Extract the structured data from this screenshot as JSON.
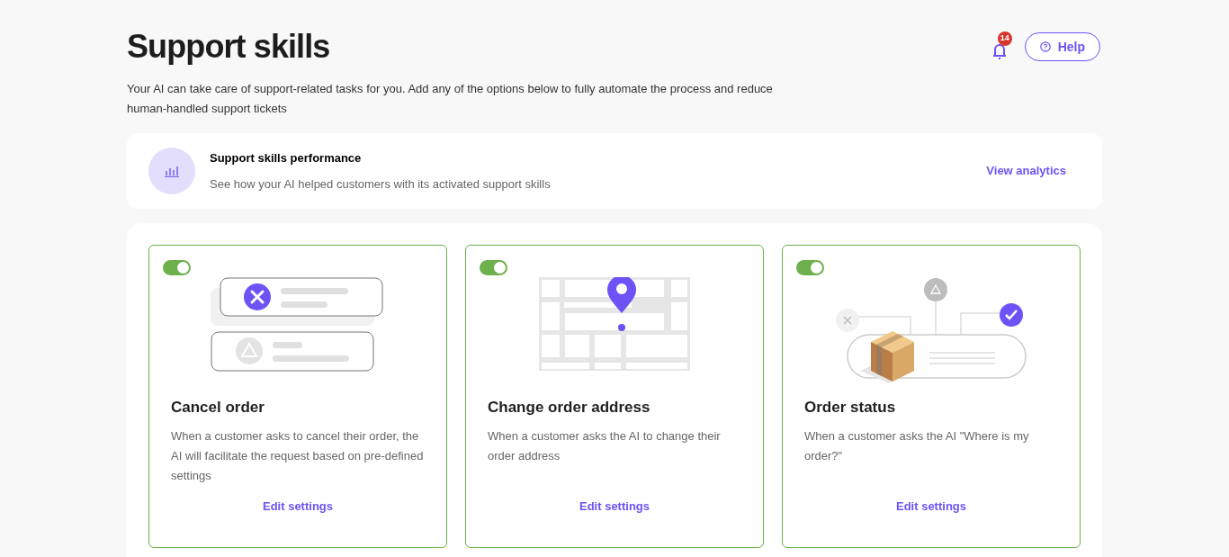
{
  "header": {
    "title": "Support skills",
    "description": "Your AI can take care of support-related tasks for you. Add any of the options below to fully automate the process and reduce human-handled support tickets",
    "notifications": {
      "count": "14"
    },
    "help_button": "Help"
  },
  "performance": {
    "title": "Support skills performance",
    "subtitle": "See how your AI helped customers with its activated support skills",
    "link": "View analytics"
  },
  "skills": [
    {
      "kind": "cancel",
      "on": true,
      "title": "Cancel order",
      "description": "When a customer asks to cancel their order, the AI will facilitate the request based on pre-defined settings",
      "link": "Edit settings"
    },
    {
      "kind": "address",
      "on": true,
      "title": "Change order address",
      "description": "When a customer asks the AI to change their order address",
      "link": "Edit settings"
    },
    {
      "kind": "status",
      "on": true,
      "title": "Order status",
      "description": "When a customer asks the AI \"Where is my order?\"",
      "link": "Edit settings"
    }
  ]
}
